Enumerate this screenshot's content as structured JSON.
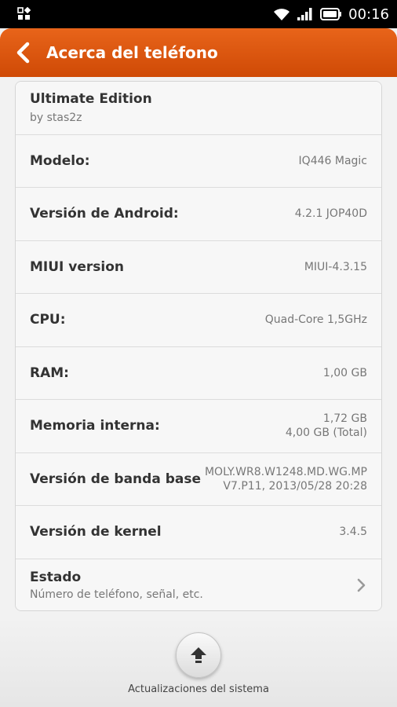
{
  "status_bar": {
    "time": "00:16",
    "icons": [
      "apps-grid-icon",
      "wifi-icon",
      "signal-icon",
      "battery-icon"
    ]
  },
  "header": {
    "title": "Acerca del teléfono",
    "back_icon": "back-arrow-icon",
    "color": "#d9550e"
  },
  "info": {
    "edition_title": "Ultimate Edition",
    "edition_sub": "by stas2z",
    "rows": [
      {
        "label": "Modelo:",
        "value": "IQ446 Magic"
      },
      {
        "label": "Versión de Android:",
        "value": "4.2.1 JOP40D"
      },
      {
        "label": "MIUI version",
        "value": "MIUI-4.3.15"
      },
      {
        "label": "CPU:",
        "value": "Quad-Core 1,5GHz"
      },
      {
        "label": "RAM:",
        "value": "1,00 GB"
      },
      {
        "label": "Memoria interna:",
        "value_line1": "1,72 GB",
        "value_line2": "4,00 GB (Total)"
      },
      {
        "label": "Versión de banda base",
        "value_line1": "MOLY.WR8.W1248.MD.WG.MP",
        "value_line2": "V7.P11, 2013/05/28 20:28"
      },
      {
        "label": "Versión de kernel",
        "value": "3.4.5"
      }
    ],
    "estado_title": "Estado",
    "estado_sub": "Número de teléfono, señal, etc."
  },
  "bottom": {
    "update_label": "Actualizaciones del sistema",
    "update_icon": "upload-arrow-icon"
  }
}
